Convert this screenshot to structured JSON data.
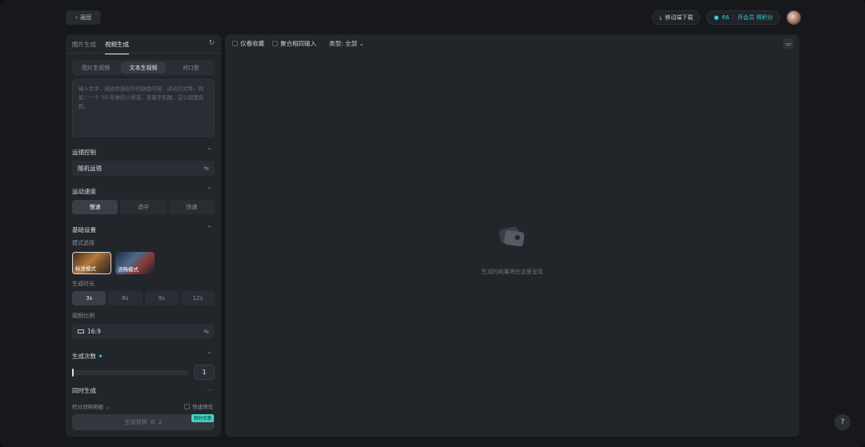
{
  "topbar": {
    "back_label": "返回",
    "mobile_download": "移动端下载",
    "credits": "66",
    "vip_label": "开会员 得积分"
  },
  "left": {
    "tabs": [
      "图片生成",
      "视频生成"
    ],
    "mode_tabs": [
      "图片生视频",
      "文本生视频",
      "对口型"
    ],
    "prompt_placeholder": "输入文字，描述你想创作的画面内容、运动方式等。例如：一个 3D 形象的小男孩，穿着宇航服，在公园里奔跑。",
    "camera_control": {
      "title": "运镜控制",
      "value": "随机运镜"
    },
    "motion_speed": {
      "title": "运动速度",
      "options": [
        "慢速",
        "适中",
        "快速"
      ]
    },
    "basic_settings": {
      "title": "基础设置",
      "model_label": "模式选择",
      "models": [
        "标准模式",
        "流畅模式"
      ],
      "duration_label": "生成时长",
      "durations": [
        "3s",
        "6s",
        "9s",
        "12s"
      ],
      "ratio_label": "视频比例",
      "ratio_value": "16:9"
    },
    "count": {
      "title": "生成次数",
      "value": "1"
    },
    "simultaneous": "同时生成",
    "credits_detail": "积分消耗明细",
    "fast_preview": "快速预览",
    "generate_label": "生成视频",
    "generate_cost": "2",
    "promo_badge": "限时优惠"
  },
  "right": {
    "filter_favorites": "仅看收藏",
    "filter_aggregate": "聚合相同输入",
    "type_filter": "类型: 全部",
    "empty_text": "生成的结果将在这里呈现"
  },
  "help_label": "?"
}
